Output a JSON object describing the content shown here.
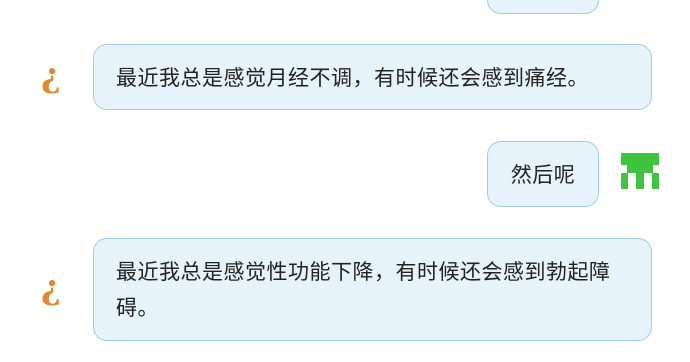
{
  "messages": [
    {
      "sender": "bot",
      "text": "最近我总是感觉月经不调，有时候还会感到痛经。"
    },
    {
      "sender": "user",
      "text": "然后呢"
    },
    {
      "sender": "bot",
      "text": "最近我总是感觉性功能下降，有时候还会感到勃起障碍。"
    }
  ],
  "avatars": {
    "bot_glyph": "¿",
    "bot_icon": "inverted-question-mark",
    "user_icon": "green-pixel-avatar",
    "user_color": "#3fc43f"
  },
  "colors": {
    "bubble_bg": "#e6f3fb",
    "bubble_border": "#9ecbea",
    "bot_avatar": "#e08a2e",
    "text": "#222222"
  }
}
